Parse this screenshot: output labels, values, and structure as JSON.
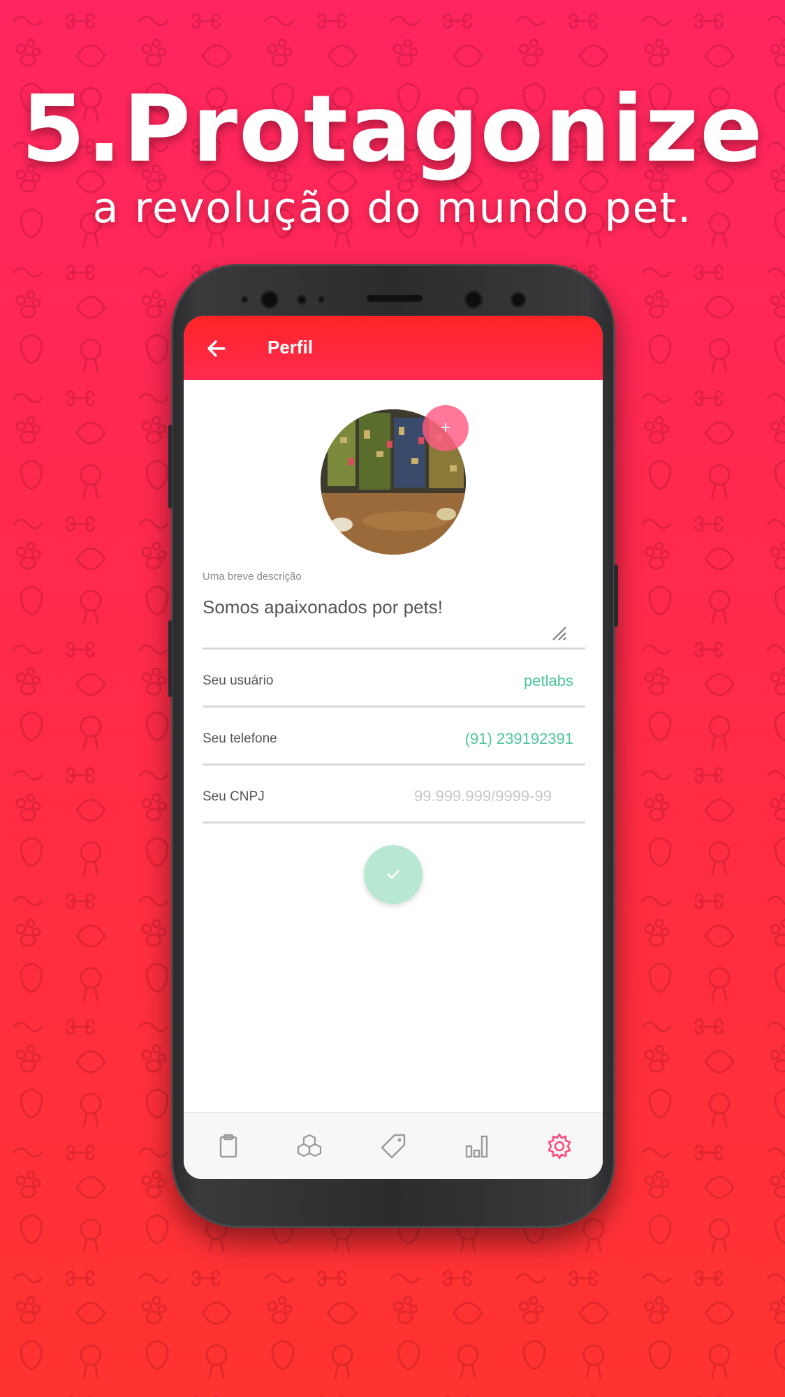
{
  "headline": "5.Protagonize",
  "subheadline": "a revolução do mundo pet.",
  "app_bar": {
    "title": "Perfil",
    "back_icon": "arrow-left-icon"
  },
  "profile": {
    "photo_icon": "store-photo",
    "add_photo_label": "+"
  },
  "form": {
    "description_label": "Uma breve descrição",
    "description_value": "Somos apaixonados por pets!",
    "username_label": "Seu usuário",
    "username_value": "petlabs",
    "phone_label": "Seu telefone",
    "phone_value": "(91) 239192391",
    "cnpj_label": "Seu CNPJ",
    "cnpj_placeholder": "99.999.999/9999-99",
    "confirm_icon": "check-icon"
  },
  "bottom_nav": [
    {
      "icon": "clipboard-icon",
      "active": false
    },
    {
      "icon": "boxes-icon",
      "active": false
    },
    {
      "icon": "tag-icon",
      "active": false
    },
    {
      "icon": "bar-chart-icon",
      "active": false
    },
    {
      "icon": "gear-icon",
      "active": true
    }
  ],
  "colors": {
    "brand": "#ff2a4f",
    "accent_green": "#4cc59a",
    "active_nav": "#ff4a7a",
    "inactive_nav": "#9a9a9a"
  }
}
